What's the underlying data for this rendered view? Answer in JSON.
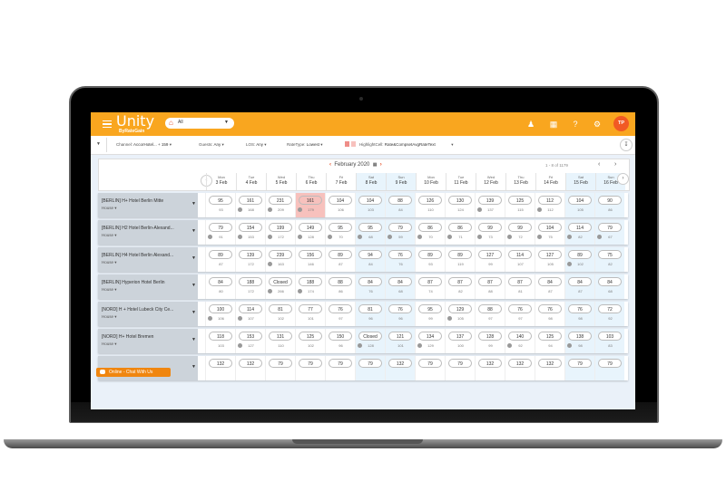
{
  "app": {
    "name": "Unity",
    "sub": "ByRateGain",
    "property_selected": "All",
    "user_initials": "TP"
  },
  "toolbar_icons": [
    "users-icon",
    "apps-grid-icon",
    "help-icon",
    "settings-icon"
  ],
  "filters": {
    "channel_label": "Channel:",
    "channel_value": "AccorHotel... + 159",
    "guests_label": "Guests:",
    "guests_value": "Any",
    "los_label": "LOS:",
    "los_value": "Any",
    "ratetype_label": "RateType:",
    "ratetype_value": "Lowest",
    "highlight_label": "HighlightCell:",
    "highlight_value": "Rate&CompsetAvgRateText"
  },
  "calendar": {
    "month": "February 2020",
    "pager": "1 - 8 of 1179",
    "days": [
      {
        "dn": "Mon",
        "dd": "3 Feb",
        "weekend": false
      },
      {
        "dn": "Tue",
        "dd": "4 Feb",
        "weekend": false
      },
      {
        "dn": "Wed",
        "dd": "5 Feb",
        "weekend": false
      },
      {
        "dn": "Thu",
        "dd": "6 Feb",
        "weekend": false
      },
      {
        "dn": "Fri",
        "dd": "7 Feb",
        "weekend": false
      },
      {
        "dn": "Sat",
        "dd": "8 Feb",
        "weekend": true
      },
      {
        "dn": "Sun",
        "dd": "9 Feb",
        "weekend": true
      },
      {
        "dn": "Mon",
        "dd": "10 Feb",
        "weekend": false
      },
      {
        "dn": "Tue",
        "dd": "11 Feb",
        "weekend": false
      },
      {
        "dn": "Wed",
        "dd": "12 Feb",
        "weekend": false
      },
      {
        "dn": "Thu",
        "dd": "13 Feb",
        "weekend": false
      },
      {
        "dn": "Fri",
        "dd": "14 Feb",
        "weekend": false
      },
      {
        "dn": "Sat",
        "dd": "15 Feb",
        "weekend": true
      },
      {
        "dn": "Sun",
        "dd": "16 Feb",
        "weekend": true
      }
    ]
  },
  "hotels": [
    {
      "name": "[BERLIN] H+ Hotel Berlin Mitte",
      "type": "House",
      "rates": [
        "95",
        "161",
        "231",
        "161",
        "104",
        "104",
        "88",
        "126",
        "130",
        "139",
        "125",
        "112",
        "104",
        "90"
      ],
      "avgs": [
        "93",
        "168",
        "209",
        "179",
        "106",
        "103",
        "84",
        "110",
        "124",
        "137",
        "115",
        "112",
        "105",
        "86"
      ],
      "dots": [
        0,
        1,
        1,
        1,
        0,
        0,
        0,
        0,
        0,
        1,
        0,
        1,
        0,
        0
      ],
      "highlight": 3
    },
    {
      "name": "[BERLIN] H2 Hotel Berlin-Alexand...",
      "type": "House",
      "rates": [
        "79",
        "154",
        "199",
        "149",
        "95",
        "95",
        "79",
        "86",
        "86",
        "99",
        "99",
        "104",
        "114",
        "79"
      ],
      "avgs": [
        "91",
        "153",
        "172",
        "128",
        "70",
        "68",
        "59",
        "70",
        "71",
        "73",
        "72",
        "75",
        "82",
        "67"
      ],
      "dots": [
        1,
        1,
        1,
        1,
        1,
        1,
        1,
        1,
        1,
        1,
        1,
        1,
        1,
        1
      ],
      "highlight": -1
    },
    {
      "name": "[BERLIN] H4 Hotel Berlin Alexand...",
      "type": "House",
      "rates": [
        "89",
        "139",
        "239",
        "156",
        "89",
        "94",
        "76",
        "89",
        "89",
        "127",
        "114",
        "127",
        "89",
        "75"
      ],
      "avgs": [
        "87",
        "172",
        "163",
        "146",
        "87",
        "84",
        "76",
        "93",
        "119",
        "99",
        "107",
        "105",
        "102",
        "82"
      ],
      "dots": [
        0,
        0,
        1,
        0,
        0,
        0,
        0,
        0,
        0,
        0,
        0,
        0,
        1,
        0
      ],
      "highlight": -1
    },
    {
      "name": "[BERLIN] Hyperion Hotel Berlin",
      "type": "House",
      "rates": [
        "84",
        "188",
        "Closed",
        "188",
        "88",
        "84",
        "84",
        "87",
        "87",
        "87",
        "87",
        "84",
        "84",
        "84"
      ],
      "avgs": [
        "80",
        "172",
        "266",
        "174",
        "86",
        "76",
        "68",
        "74",
        "82",
        "88",
        "81",
        "87",
        "87",
        "68"
      ],
      "dots": [
        0,
        0,
        1,
        1,
        0,
        0,
        0,
        0,
        0,
        0,
        0,
        0,
        0,
        0
      ],
      "highlight": -1
    },
    {
      "name": "[NORD] H + Hotel Lubeck City Ce...",
      "type": "House",
      "rates": [
        "100",
        "114",
        "81",
        "77",
        "76",
        "81",
        "76",
        "95",
        "129",
        "88",
        "76",
        "76",
        "76",
        "72"
      ],
      "avgs": [
        "106",
        "107",
        "102",
        "101",
        "97",
        "96",
        "96",
        "99",
        "105",
        "97",
        "97",
        "98",
        "98",
        "92"
      ],
      "dots": [
        1,
        1,
        0,
        0,
        0,
        0,
        0,
        0,
        1,
        0,
        0,
        0,
        0,
        0
      ],
      "highlight": -1
    },
    {
      "name": "[NORD] H+ Hotel Bremen",
      "type": "House",
      "rates": [
        "118",
        "153",
        "131",
        "125",
        "150",
        "Closed",
        "121",
        "134",
        "137",
        "128",
        "140",
        "125",
        "138",
        "103"
      ],
      "avgs": [
        "103",
        "127",
        "110",
        "102",
        "96",
        "128",
        "101",
        "129",
        "100",
        "99",
        "92",
        "94",
        "98",
        "83"
      ],
      "dots": [
        0,
        1,
        0,
        0,
        0,
        1,
        0,
        1,
        0,
        0,
        1,
        0,
        1,
        0
      ],
      "highlight": -1
    },
    {
      "name": "",
      "type": "",
      "rates": [
        "132",
        "132",
        "79",
        "79",
        "79",
        "79",
        "132",
        "79",
        "79",
        "132",
        "132",
        "132",
        "79",
        "79"
      ],
      "avgs": [],
      "dots": [],
      "highlight": -1
    }
  ],
  "chat": {
    "label": "Online - Chat With Us"
  }
}
